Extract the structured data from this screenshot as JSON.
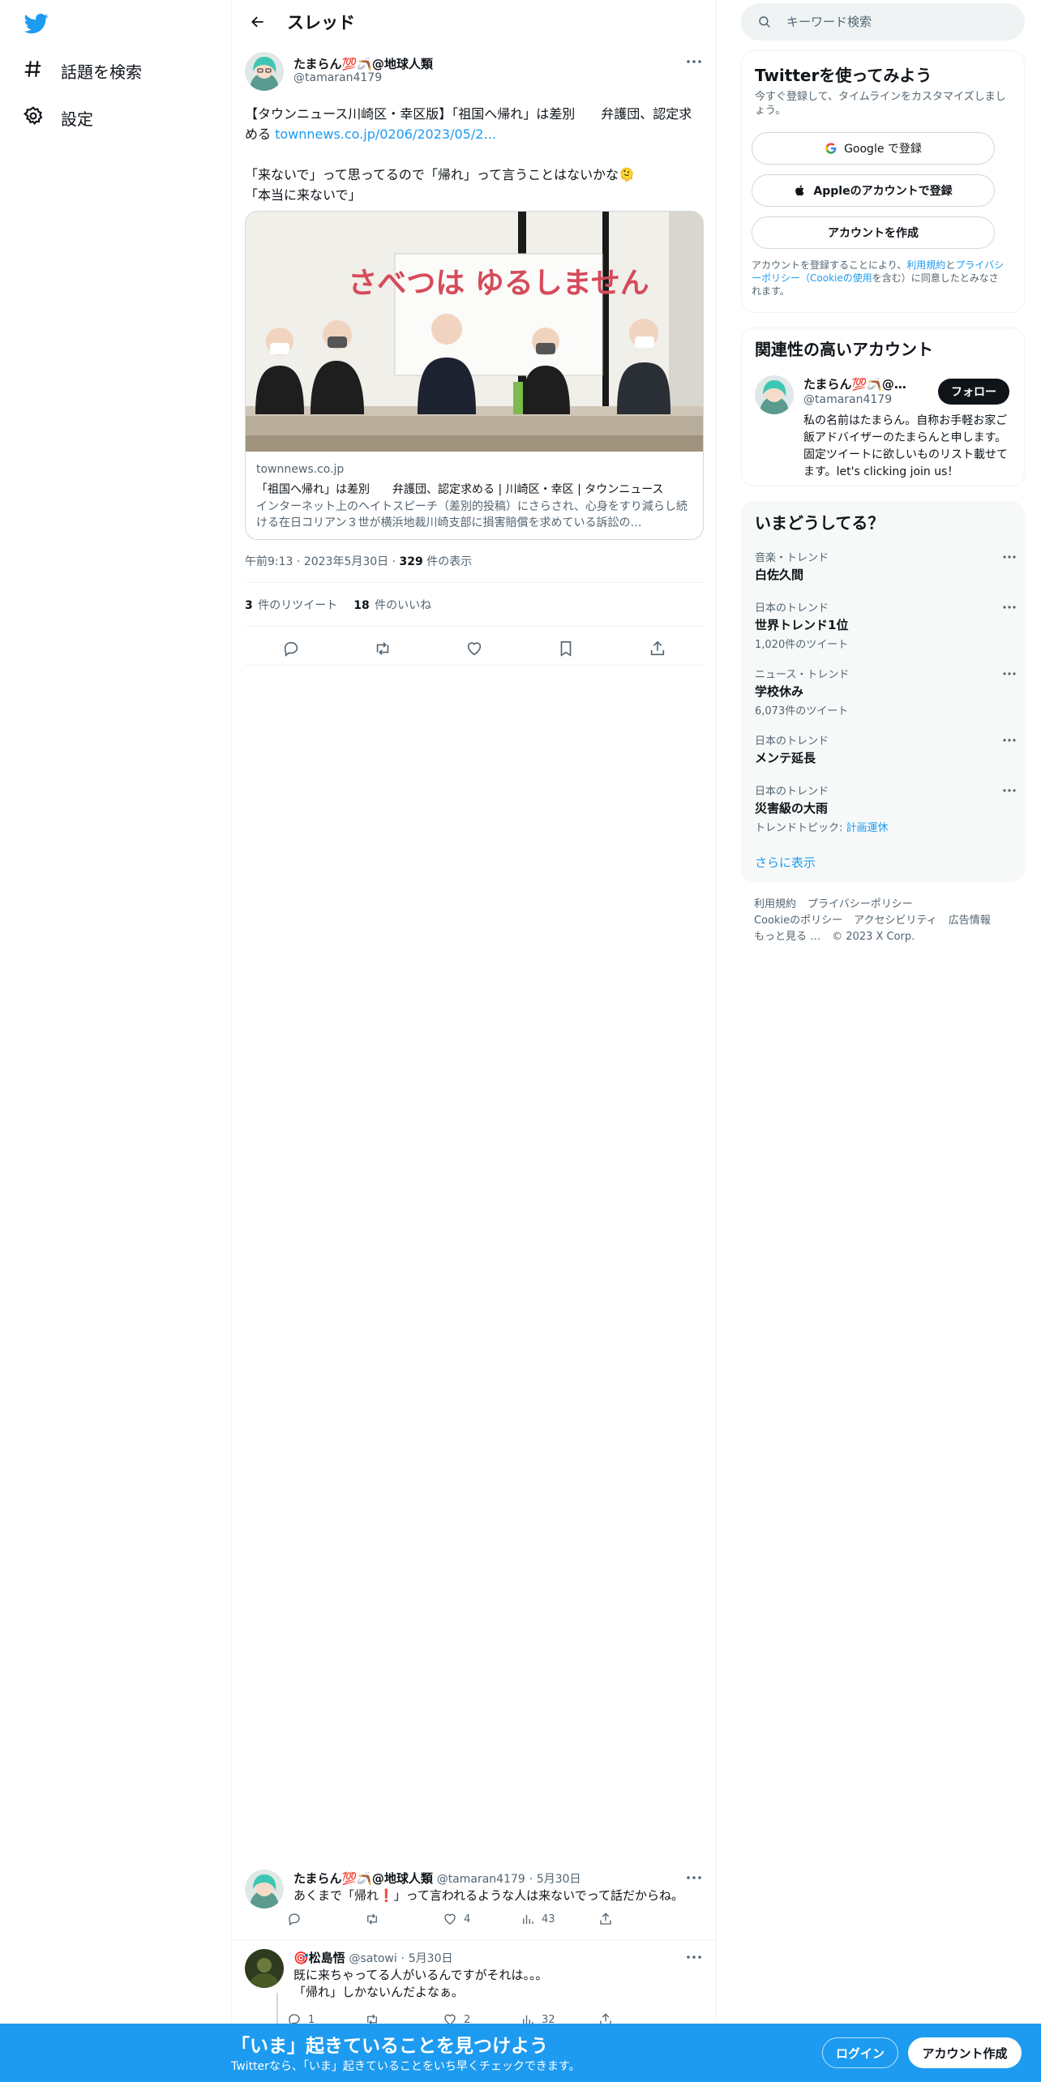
{
  "nav": {
    "explore": "話題を検索",
    "settings": "設定"
  },
  "header": {
    "title": "スレッド"
  },
  "tweet": {
    "name": "たまらん💯🪃@地球人類",
    "handle": "@tamaran4179",
    "text": "【タウンニュース川崎区・幸区版】「祖国へ帰れ」は差別　　弁護団、認定求める ",
    "link": "townnews.co.jp/0206/2023/05/2…",
    "text2": "\n\n「来ないで」って思ってるので「帰れ」って言うことはないかな🫠\n「本当に来ないで」",
    "card": {
      "banner_text": "さべつは ゆるしません",
      "domain": "townnews.co.jp",
      "title": "「祖国へ帰れ」は差別　　弁護団、認定求める | 川崎区・幸区 | タウンニュース",
      "description": "インターネット上のヘイトスピーチ（差別的投稿）にさらされ、心身をすり減らし続ける在日コリアン３世が横浜地裁川崎支部に損害賠償を求めている訴訟の…"
    },
    "time": "午前9:13",
    "date": "2023年5月30日",
    "views": "329",
    "views_label": "件の表示",
    "retweets": "3",
    "retweets_label": "件のリツイート",
    "likes": "18",
    "likes_label": "件のいいね"
  },
  "replies": [
    {
      "name": "たまらん💯🪃@地球人類",
      "handle": "@tamaran4179",
      "date": "5月30日",
      "text": "あくまで「帰れ❗️」って言われるような人は来ないでって話だからね。",
      "replies": "",
      "retweets": "",
      "likes": "4",
      "views": "43"
    },
    {
      "name": "🎯松島悟",
      "handle": "@satowi",
      "date": "5月30日",
      "text": "既に来ちゃってる人がいるんですがそれは。。。\n「帰れ」しかないんだよなぁ。",
      "replies": "1",
      "retweets": "",
      "likes": "2",
      "views": "32"
    }
  ],
  "sidebar": {
    "search_placeholder": "キーワード検索",
    "signup": {
      "title": "Twitterを使ってみよう",
      "subtitle": "今すぐ登録して、タイムラインをカスタマイズしましょう。",
      "google": "Google で登録",
      "apple": "Appleのアカウントで登録",
      "create": "アカウントを作成",
      "terms_prefix": "アカウントを登録することにより、",
      "terms_link1": "利用規約",
      "terms_and": "と",
      "terms_link2": "プライバシーポリシー（Cookieの使用",
      "terms_suffix": "を含む）に同意したとみなされます。"
    },
    "related": {
      "title": "関連性の高いアカウント",
      "name": "たまらん💯🪃@地球人類",
      "handle": "@tamaran4179",
      "follow": "フォロー",
      "bio": "私の名前はたまらん。自称お手軽お家ご飯アドバイザーのたまらんと申します。固定ツイートに欲しいものリスト載せてます。let's clicking join us！"
    },
    "trends": {
      "title": "いまどうしてる？",
      "items": [
        {
          "category": "音楽・トレンド",
          "name": "白佐久間",
          "count": ""
        },
        {
          "category": "日本のトレンド",
          "name": "世界トレンド1位",
          "count": "1,020件のツイート"
        },
        {
          "category": "ニュース・トレンド",
          "name": "学校休み",
          "count": "6,073件のツイート"
        },
        {
          "category": "日本のトレンド",
          "name": "メンテ延長",
          "count": ""
        },
        {
          "category": "日本のトレンド",
          "name": "災害級の大雨",
          "count_prefix": "トレンドトピック: ",
          "count_link": "計画運休"
        }
      ],
      "show_more": "さらに表示"
    },
    "footer": {
      "terms": "利用規約",
      "privacy": "プライバシーポリシー",
      "cookie": "Cookieのポリシー",
      "accessibility": "アクセシビリティ",
      "ads": "広告情報",
      "more": "もっと見る …",
      "copyright": "© 2023 X Corp."
    }
  },
  "bottombar": {
    "title": "「いま」起きていることを見つけよう",
    "subtitle": "Twitterなら、「いま」起きていることをいち早くチェックできます。",
    "login": "ログイン",
    "signup": "アカウント作成"
  },
  "colors": {
    "accent": "#1d9bf0",
    "text": "#0f1419",
    "muted": "#536471"
  }
}
